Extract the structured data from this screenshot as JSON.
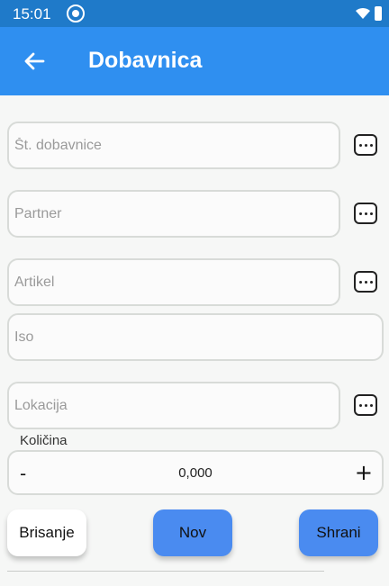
{
  "status": {
    "time": "15:01"
  },
  "appbar": {
    "title": "Dobavnica"
  },
  "fields": {
    "delivery_note": {
      "placeholder": "Št. dobavnice"
    },
    "partner": {
      "placeholder": "Partner"
    },
    "article": {
      "placeholder": "Artikel"
    },
    "iso": {
      "placeholder": "Iso"
    },
    "location": {
      "placeholder": "Lokacija"
    }
  },
  "quantity": {
    "label": "Količina",
    "value": "0,000",
    "minus": "-",
    "plus": "+"
  },
  "buttons": {
    "delete": "Brisanje",
    "new": "Nov",
    "save": "Shrani"
  },
  "colors": {
    "statusbar": "#1f7ac9",
    "appbar": "#2f8ff0",
    "primary_button": "#4a8bf0"
  },
  "icons": [
    "back-arrow-icon",
    "more-icon",
    "wifi-icon",
    "battery-icon",
    "at-sign-icon"
  ]
}
